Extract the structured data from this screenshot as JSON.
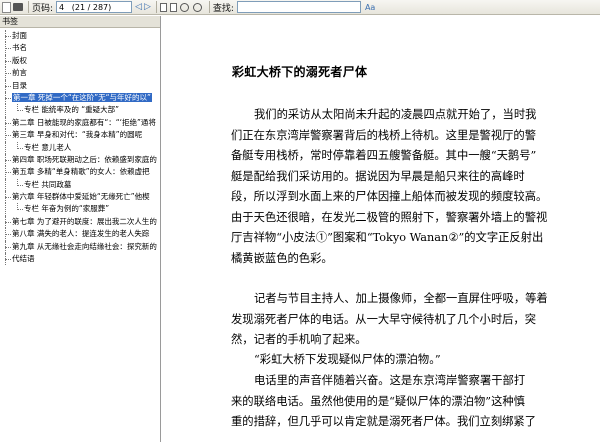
{
  "toolbar": {
    "page_label": "页码:",
    "page_value": "4   (21 / 287)",
    "search_label": "查找:",
    "search_value": "",
    "find_icon_text": "Aa"
  },
  "sidebar": {
    "header": "书签",
    "items": [
      {
        "label": "封面",
        "level": 0
      },
      {
        "label": "书名",
        "level": 0
      },
      {
        "label": "版权",
        "level": 0
      },
      {
        "label": "前言",
        "level": 0
      },
      {
        "label": "目录",
        "level": 0
      },
      {
        "label": "第一章 死掉一个“在这阶”无“与年好的以”",
        "level": 0,
        "selected": true
      },
      {
        "label": "专栏 能统率及的 “重疑大部”",
        "level": 1
      },
      {
        "label": "第二章 日被能现的家庭都有“：“‘拒绝”通将",
        "level": 0
      },
      {
        "label": "第三章 早身和对代：“我身本精”的圆呢",
        "level": 0
      },
      {
        "label": "专栏 意儿老人",
        "level": 1
      },
      {
        "label": "第四章 职场死联期动之后：依赖盛到家庭的",
        "level": 0
      },
      {
        "label": "第五章 多精“单身精歌”的女人：依赖虚把",
        "level": 0
      },
      {
        "label": "专栏 共同政墓",
        "level": 1
      },
      {
        "label": "第六章 年轻群体中爱延始“无缘死亡”他楔",
        "level": 0
      },
      {
        "label": "专栏 年奋为例的“家服葬”",
        "level": 1
      },
      {
        "label": "第七章 为了避开的联度：展出我二次人生的",
        "level": 0
      },
      {
        "label": "第八章 满失的老人：提连发生的老人失踪",
        "level": 0
      },
      {
        "label": "第九章 从无缘社会走向结缘社会：探究新的",
        "level": 0
      },
      {
        "label": "代结语",
        "level": 0
      }
    ]
  },
  "content": {
    "chapter_title": "彩虹大桥下的溺死者尸体",
    "p1_lines": [
      "我们的采访从太阳尚未升起的凌晨四点就开始了，当时我",
      "们正在东京湾岸警察署背后的栈桥上待机。这里是警视厅的警",
      "备艇专用栈桥，常时停靠着四五艘警备艇。其中一艘“天鹅号”",
      "艇是配给我们采访用的。据说因为早晨是船只来往的高峰时",
      "段，所以浮到水面上来的尸体因撞上船体而被发现的频度较高。",
      "由于天色还很暗，在发光二极管的照射下，警察署外墙上的警视",
      "厅吉祥物“小皮法①”图案和“Tokyo Wanan②”的文字正反射出",
      "橘黄嵌蓝色的色彩。"
    ],
    "p2_lines": [
      "记者与节目主持人、加上摄像师，全都一直屏住呼吸，等着",
      "发现溺死者尸体的电话。从一大早守候待机了几个小时后，突",
      "然，记者的手机响了起来。"
    ],
    "p3_lines": [
      "“彩虹大桥下发现疑似尸体的漂泊物。”"
    ],
    "p4_lines": [
      "电话里的声音伴随着兴奋。这是东京湾岸警察署干部打",
      "来的联络电话。虽然他使用的是“疑似尸体的漂泊物”这种慎",
      "重的措辞，但几乎可以肯定就是溺死者尸体。我们立刻绑紧了"
    ]
  }
}
